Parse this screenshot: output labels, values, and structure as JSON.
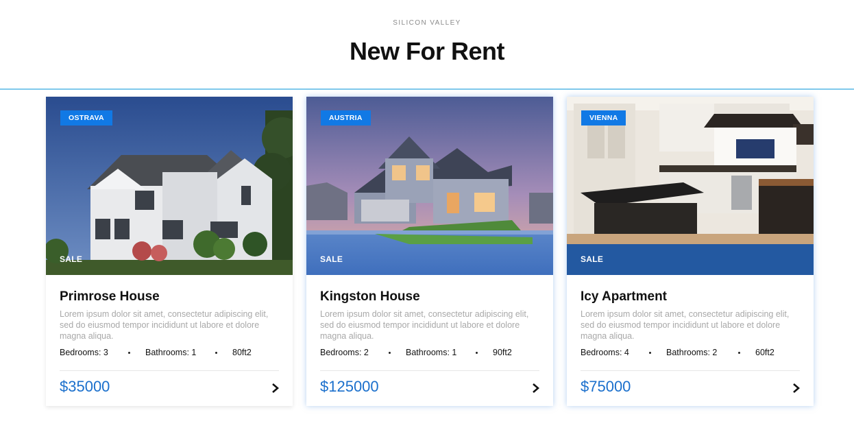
{
  "header": {
    "eyebrow": "SILICON VALLEY",
    "title": "New For Rent"
  },
  "colors": {
    "accent": "#1179e5",
    "price": "#1a6fcc",
    "divider": "#7fc9ec"
  },
  "cards": [
    {
      "location": "OSTRAVA",
      "sale": "SALE",
      "title": "Primrose House",
      "description": "Lorem ipsum dolor sit amet, consectetur adipiscing elit, sed do eiusmod tempor incididunt ut labore et dolore magna aliqua.",
      "bedrooms": "Bedrooms: 3",
      "bathrooms": "Bathrooms: 1",
      "area": "80ft2",
      "price": "$35000",
      "arrow_icon": "chevron-right-icon"
    },
    {
      "location": "AUSTRIA",
      "sale": "SALE",
      "title": "Kingston House",
      "description": "Lorem ipsum dolor sit amet, consectetur adipiscing elit, sed do eiusmod tempor incididunt ut labore et dolore magna aliqua.",
      "bedrooms": "Bedrooms: 2",
      "bathrooms": "Bathrooms: 1",
      "area": "90ft2",
      "price": "$125000",
      "arrow_icon": "chevron-right-icon"
    },
    {
      "location": "VIENNA",
      "sale": "SALE",
      "title": "Icy Apartment",
      "description": "Lorem ipsum dolor sit amet, consectetur adipiscing elit, sed do eiusmod tempor incididunt ut labore et dolore magna aliqua.",
      "bedrooms": "Bedrooms: 4",
      "bathrooms": "Bathrooms: 2",
      "area": "60ft2",
      "price": "$75000",
      "arrow_icon": "chevron-right-icon"
    }
  ]
}
